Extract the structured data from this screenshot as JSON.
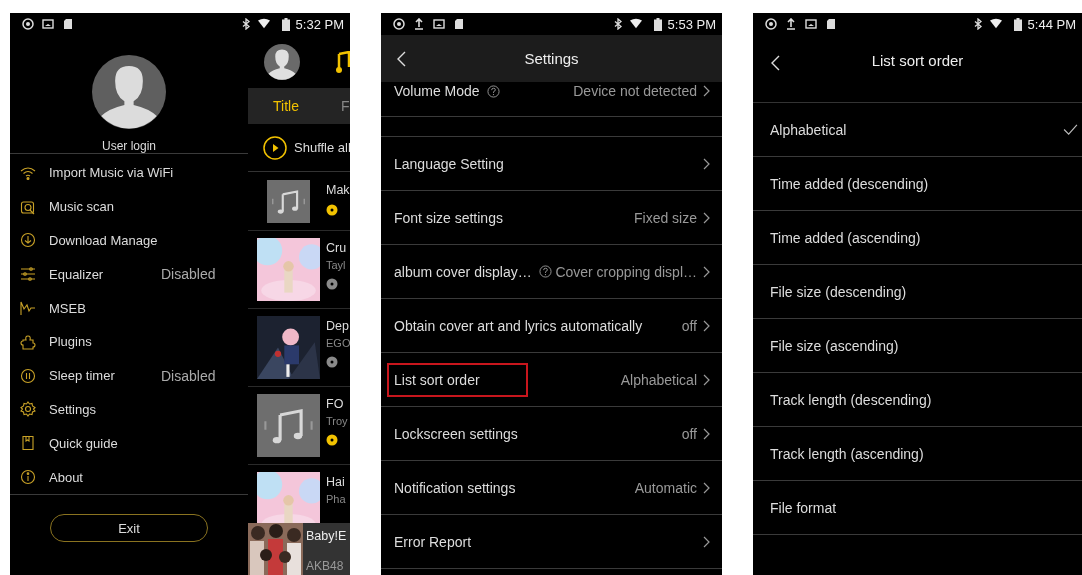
{
  "screens": [
    {
      "kind": "drawer",
      "status_bar": {
        "time": "5:32 PM"
      },
      "drawer": {
        "user_label": "User login",
        "items": [
          {
            "label": "Import Music via WiFi"
          },
          {
            "label": "Music scan"
          },
          {
            "label": "Download Manage"
          },
          {
            "label": "Equalizer",
            "value": "Disabled"
          },
          {
            "label": "MSEB"
          },
          {
            "label": "Plugins"
          },
          {
            "label": "Sleep timer",
            "value": "Disabled"
          },
          {
            "label": "Settings"
          },
          {
            "label": "Quick guide"
          },
          {
            "label": "About"
          }
        ],
        "exit": "Exit"
      },
      "library": {
        "tabs": [
          {
            "label": "Title",
            "selected": true
          },
          {
            "label": "F",
            "selected": false
          }
        ],
        "shuffle": "Shuffle all",
        "songs": [
          {
            "kind": "placeholder",
            "title": "Mak",
            "color": "#f2c200"
          },
          {
            "kind": "picture",
            "title": "Cru",
            "artist": "Tayl",
            "color": "#8a8a8a"
          },
          {
            "kind": "picture",
            "title": "Dep",
            "artist": "EGO",
            "color": "#8a8a8a"
          },
          {
            "kind": "placeholder",
            "title": "FO",
            "artist": "Troy",
            "color": "#f2c200"
          },
          {
            "kind": "picture",
            "title": "Hai",
            "artist": "Pha"
          }
        ],
        "mini_player": {
          "title": "Baby!E",
          "artist": "AKB48"
        }
      }
    },
    {
      "kind": "settings",
      "status_bar": {
        "time": "5:53 PM",
        "upload": true
      },
      "title": "Settings",
      "settings": [
        {
          "kind": "setting",
          "label": "Volume Mode",
          "help": true,
          "value": "Device not detected"
        },
        {
          "kind": "spacer"
        },
        {
          "kind": "setting",
          "label": "Language Setting"
        },
        {
          "kind": "setting",
          "label": "Font size settings",
          "value": "Fixed size"
        },
        {
          "kind": "setting",
          "label": "album cover display…",
          "help": true,
          "value": "Cover cropping displ…"
        },
        {
          "kind": "setting",
          "label": "Obtain cover art and lyrics automatically",
          "value": "off"
        },
        {
          "kind": "setting",
          "label": "List sort order",
          "value": "Alphabetical",
          "highlighted": true
        },
        {
          "kind": "setting",
          "label": "Lockscreen settings",
          "value": "off"
        },
        {
          "kind": "setting",
          "label": "Notification settings",
          "value": "Automatic"
        },
        {
          "kind": "setting",
          "label": "Error Report"
        }
      ]
    },
    {
      "kind": "options",
      "status_bar": {
        "time": "5:44 PM",
        "upload": true
      },
      "title": "List sort order",
      "options": [
        {
          "label": "Alphabetical",
          "selected": true
        },
        {
          "label": "Time added (descending)",
          "selected": false
        },
        {
          "label": "Time added (ascending)",
          "selected": false
        },
        {
          "label": "File size (descending)",
          "selected": false
        },
        {
          "label": "File size (ascending)",
          "selected": false
        },
        {
          "label": "Track length (descending)",
          "selected": false
        },
        {
          "label": "Track length (ascending)",
          "selected": false
        },
        {
          "label": "File format",
          "selected": false
        }
      ]
    }
  ]
}
